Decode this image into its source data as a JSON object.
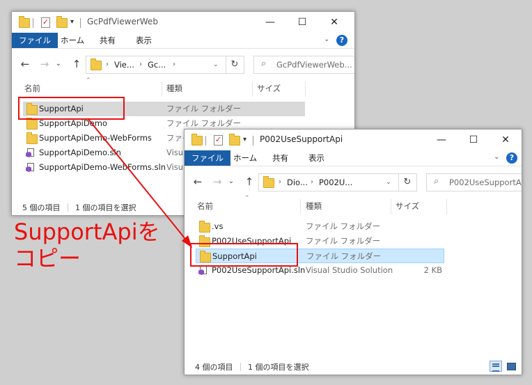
{
  "window_back": {
    "title": "GcPdfViewerWeb",
    "controls": {
      "minimize": "—",
      "maximize": "☐",
      "close": "✕"
    },
    "ribbon_tabs": [
      "ファイル",
      "ホーム",
      "共有",
      "表示"
    ],
    "address": [
      "Vie...",
      "Gc..."
    ],
    "search_placeholder": "GcPdfViewerWeb...",
    "columns": {
      "name": "名前",
      "type": "種類",
      "size": "サイズ"
    },
    "rows": [
      {
        "name": "SupportApi",
        "type": "ファイル フォルダー",
        "icon": "folder-icon"
      },
      {
        "name": "SupportApiDemo",
        "type": "ファイル フォルダー",
        "icon": "folder-icon"
      },
      {
        "name": "SupportApiDemo-WebForms",
        "type": "ファイ...",
        "icon": "folder-icon"
      },
      {
        "name": "SupportApiDemo.sln",
        "type": "Visua...",
        "icon": "vs-solution-icon"
      },
      {
        "name": "SupportApiDemo-WebForms.sln",
        "type": "Visua...",
        "icon": "vs-solution-icon"
      }
    ],
    "status": {
      "count": "5 個の項目",
      "selected": "1 個の項目を選択"
    }
  },
  "window_front": {
    "title": "P002UseSupportApi",
    "controls": {
      "minimize": "—",
      "maximize": "☐",
      "close": "✕"
    },
    "ribbon_tabs": [
      "ファイル",
      "ホーム",
      "共有",
      "表示"
    ],
    "address": [
      "Dio...",
      "P002U..."
    ],
    "search_placeholder": "P002UseSupportA...",
    "columns": {
      "name": "名前",
      "type": "種類",
      "size": "サイズ"
    },
    "rows": [
      {
        "name": ".vs",
        "type": "ファイル フォルダー",
        "size": "",
        "icon": "folder-icon"
      },
      {
        "name": "P002UseSupportApi",
        "type": "ファイル フォルダー",
        "size": "",
        "icon": "folder-icon"
      },
      {
        "name": "SupportApi",
        "type": "ファイル フォルダー",
        "size": "",
        "icon": "folder-icon"
      },
      {
        "name": "P002UseSupportApi.sln",
        "type": "Visual Studio Solution",
        "size": "2 KB",
        "icon": "vs-solution-icon"
      }
    ],
    "status": {
      "count": "4 個の項目",
      "selected": "1 個の項目を選択"
    }
  },
  "annotation": {
    "line1": "SupportApiを",
    "line2": "コピー",
    "color": "#e81010"
  },
  "colors": {
    "ribbon_file_tab": "#1a5ea8",
    "selection_blue": "#cce8ff",
    "selection_grey": "#d9d9d9",
    "annotation_red": "#e81010"
  }
}
